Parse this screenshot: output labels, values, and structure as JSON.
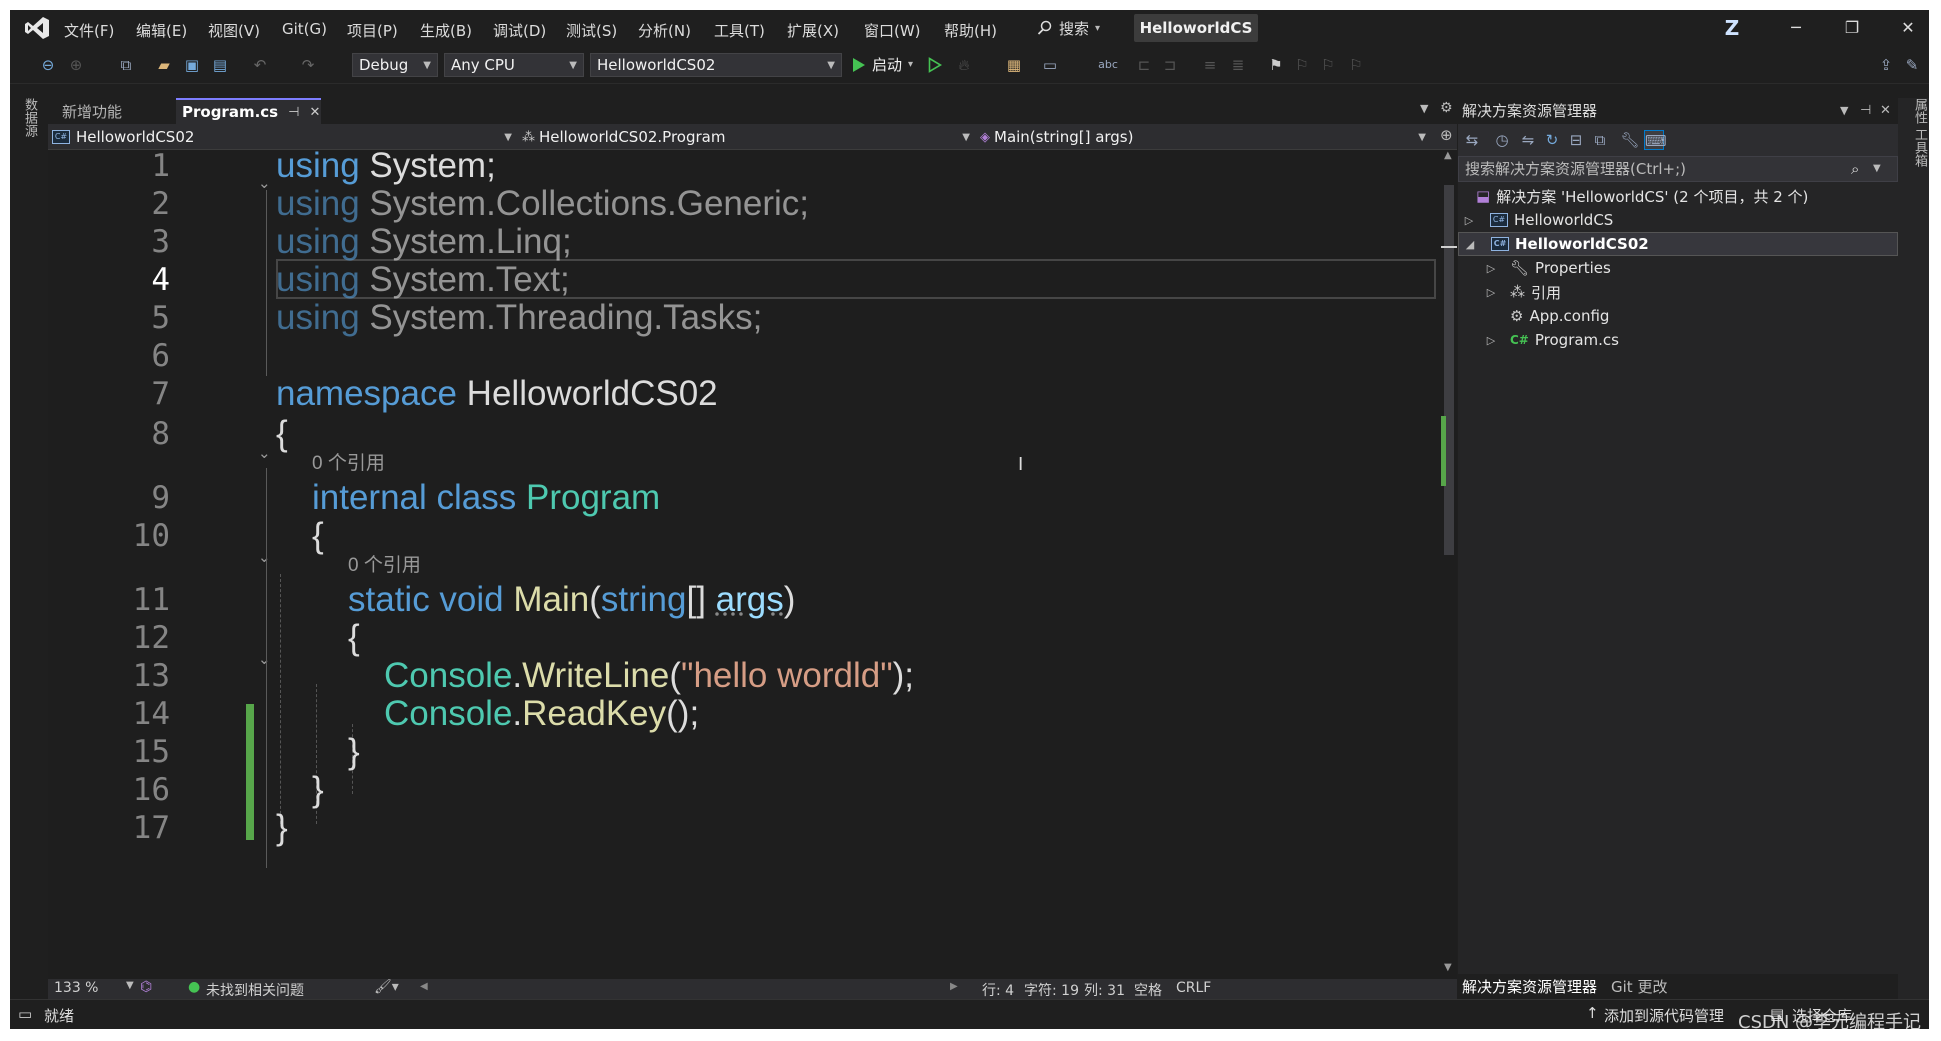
{
  "menu": {
    "items": [
      "文件(F)",
      "编辑(E)",
      "视图(V)",
      "Git(G)",
      "项目(P)",
      "生成(B)",
      "调试(D)",
      "测试(S)",
      "分析(N)",
      "工具(T)",
      "扩展(X)",
      "窗口(W)",
      "帮助(H)"
    ],
    "search_label": "搜索",
    "solution_title": "HelloworldCS",
    "avatar_letter": "Z"
  },
  "toolbar": {
    "config": "Debug",
    "platform": "Any CPU",
    "startup_project": "HelloworldCS02",
    "start_label": "启动"
  },
  "left_strip": {
    "label": "数据源"
  },
  "tabs": [
    {
      "label": "新增功能",
      "active": false
    },
    {
      "label": "Program.cs",
      "active": true
    }
  ],
  "navbar": {
    "project": "HelloworldCS02",
    "class": "HelloworldCS02.Program",
    "member": "Main(string[] args)"
  },
  "editor": {
    "line_numbers": [
      "1",
      "2",
      "3",
      "4",
      "5",
      "6",
      "7",
      "8",
      "9",
      "10",
      "11",
      "12",
      "13",
      "14",
      "15",
      "16",
      "17"
    ],
    "current_line": "4",
    "codelens": "0 个引用",
    "lines": {
      "l1_kw": "using",
      "l1_rest": " System;",
      "l2_kw": "using",
      "l2_rest": " System.Collections.Generic;",
      "l3_kw": "using",
      "l3_rest": " System.Linq;",
      "l4_kw": "using",
      "l4_rest": " System.Text;",
      "l5_kw": "using",
      "l5_rest": " System.Threading.Tasks;",
      "l7_kw": "namespace",
      "l7_rest": " HelloworldCS02",
      "brace_open": "{",
      "brace_close": "}",
      "l9_kw": "internal class",
      "l9_type": "Program",
      "l11_kw": "static void",
      "l11_fn": "Main",
      "l11_p1": "(",
      "l11_t": "string",
      "l11_p2": "[] ",
      "l11_arg": "args",
      "l11_p3": ")",
      "l13_type": "Console",
      "l13_dot": ".",
      "l13_fn": "WriteLine",
      "l13_p1": "(",
      "l13_str": "\"hello wordld\"",
      "l13_p2": ");",
      "l14_type": "Console",
      "l14_dot": ".",
      "l14_fn": "ReadKey",
      "l14_p": "();"
    }
  },
  "editor_status": {
    "zoom": "133 %",
    "issues": "未找到相关问题",
    "row": "行: 4",
    "char": "字符: 19",
    "col": "列: 31",
    "whitespace": "空格",
    "eol": "CRLF"
  },
  "solution_explorer": {
    "title": "解决方案资源管理器",
    "search_placeholder": "搜索解决方案资源管理器(Ctrl+;)",
    "tree": [
      {
        "label": "解决方案 'HelloworldCS' (2 个项目，共 2 个)",
        "depth": 0
      },
      {
        "label": "HelloworldCS",
        "depth": 1
      },
      {
        "label": "HelloworldCS02",
        "depth": 1,
        "selected": true
      },
      {
        "label": "Properties",
        "depth": 2
      },
      {
        "label": "引用",
        "depth": 2
      },
      {
        "label": "App.config",
        "depth": 2
      },
      {
        "label": "Program.cs",
        "depth": 2
      }
    ],
    "footer_tab1": "解决方案资源管理器",
    "footer_tab2": "Git 更改"
  },
  "right_strip": {
    "label": "属性 工具箱"
  },
  "statusbar": {
    "ready": "就绪",
    "add_source": "添加到源代码管理",
    "select_repo": "选择仓库",
    "watermark": "CSDN @李元编程手记"
  }
}
